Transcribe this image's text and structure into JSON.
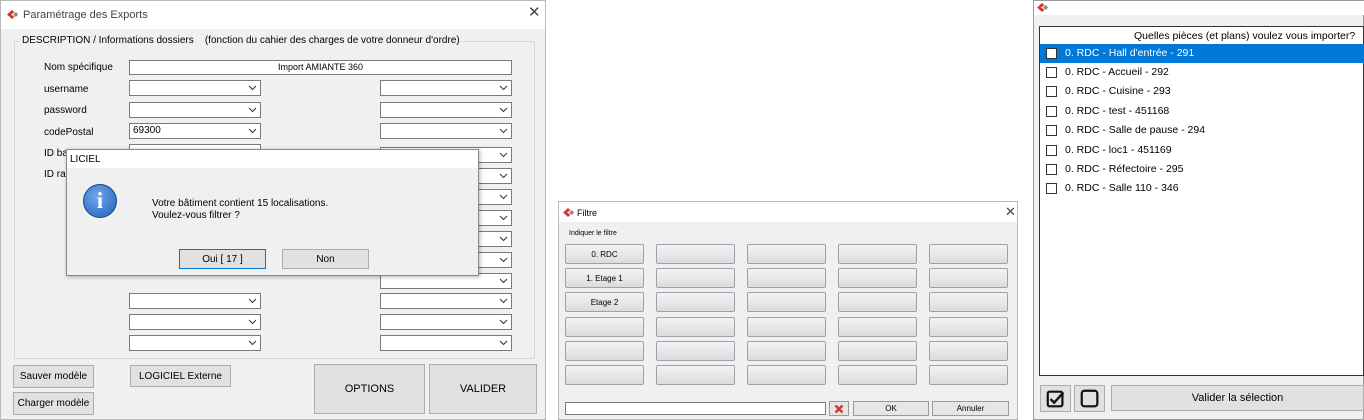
{
  "export_window": {
    "title": "Paramétrage des Exports",
    "group_title": "DESCRIPTION / Informations dossiers",
    "group_subtitle": "(fonction du cahier des charges de votre donneur d'ordre)",
    "fields": [
      {
        "label": "Nom spécifique",
        "value": "Import AMIANTE 360"
      },
      {
        "label": "username",
        "value": ""
      },
      {
        "label": "password",
        "value": ""
      },
      {
        "label": "codePostal",
        "value": "69300"
      },
      {
        "label": "ID bat",
        "value": ""
      },
      {
        "label": "ID rap",
        "value": ""
      }
    ],
    "buttons": {
      "save_model": "Sauver modèle",
      "load_model": "Charger modèle",
      "external": "LOGICIEL Externe",
      "options": "OPTIONS",
      "validate": "VALIDER"
    }
  },
  "dialog": {
    "title": "LICIEL",
    "message_line1": "Votre bâtiment contient 15 localisations.",
    "message_line2": "Voulez-vous filtrer ?",
    "yes_label": "Oui  [ 17 ]",
    "no_label": "Non",
    "info_glyph": "i"
  },
  "filter_window": {
    "title": "Filtre",
    "hint": "Indiquer le filtre",
    "buttons": [
      "0. RDC",
      "1. Etage 1",
      "Etage 2"
    ],
    "ok_label": "OK",
    "cancel_label": "Annuler",
    "input_value": ""
  },
  "import_window": {
    "question": "Quelles pièces (et plans) voulez vous importer?",
    "rooms": [
      "0. RDC - Hall d'entrée - 291",
      "0. RDC - Accueil - 292",
      "0. RDC - Cuisine - 293",
      "0. RDC - test - 451168",
      "0. RDC - Salle de pause - 294",
      "0. RDC - loc1 - 451169",
      "0. RDC - Réfectoire - 295",
      "0. RDC - Salle 110 - 346"
    ],
    "selected_index": 0,
    "validate_label": "Valider la sélection"
  },
  "colors": {
    "accent": "#0078d7",
    "logo_red": "#d9352b"
  }
}
